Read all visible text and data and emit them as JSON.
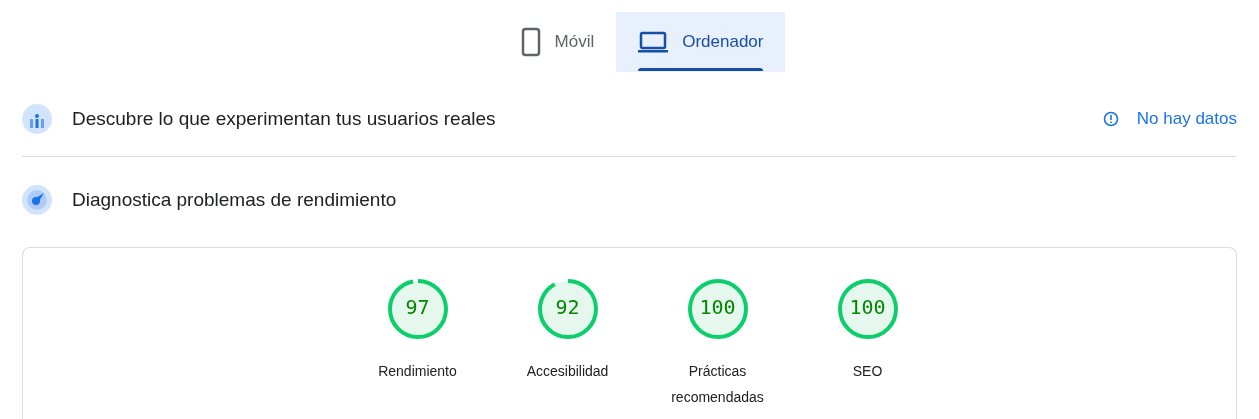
{
  "tabs": [
    {
      "kind": "phone",
      "label": "Móvil",
      "selected": false
    },
    {
      "kind": "laptop",
      "label": "Ordenador",
      "selected": true
    }
  ],
  "field_data": {
    "title": "Descubre lo que experimentan tus usuarios reales",
    "status": "No hay datos"
  },
  "diagnostics": {
    "title": "Diagnostica problemas de rendimiento",
    "scores": [
      {
        "value": "97",
        "label": "Rendimiento"
      },
      {
        "value": "92",
        "label": "Accesibilidad"
      },
      {
        "value": "100",
        "label": "Prácticas recomendadas"
      },
      {
        "value": "100",
        "label": "SEO"
      }
    ]
  }
}
